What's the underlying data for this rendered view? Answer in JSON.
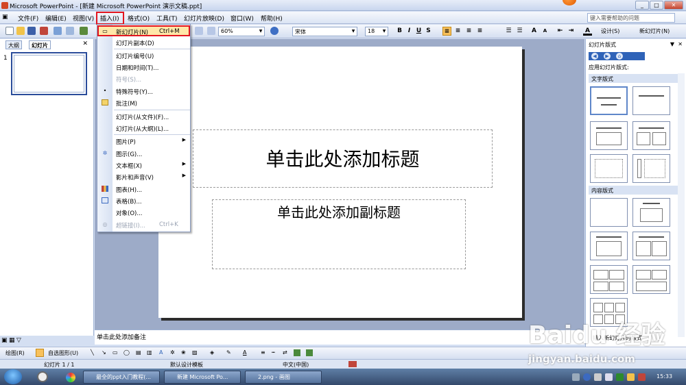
{
  "window": {
    "title": "Microsoft PowerPoint - [新建 Microsoft PowerPoint 演示文稿.ppt]"
  },
  "menubar": {
    "items": [
      "文件(F)",
      "编辑(E)",
      "视图(V)",
      "插入(I)",
      "格式(O)",
      "工具(T)",
      "幻灯片放映(D)",
      "窗口(W)",
      "帮助(H)"
    ],
    "help_placeholder": "键入需要帮助的问题"
  },
  "toolbar": {
    "zoom": "60%",
    "font": "宋体",
    "font_size": "18",
    "bold": "B",
    "italic": "I",
    "underline": "U",
    "shadow": "S",
    "design_label": "设计(S)",
    "new_slide_label": "新幻灯片(N)"
  },
  "insert_menu": {
    "items": [
      {
        "label": "新幻灯片(N)",
        "shortcut": "Ctrl+M",
        "icon": "new-slide-icon"
      },
      {
        "label": "幻灯片副本(D)"
      },
      {
        "label": "幻灯片编号(U)"
      },
      {
        "label": "日期和时间(T)..."
      },
      {
        "label": "符号(S)...",
        "disabled": true
      },
      {
        "label": "特殊符号(Y)...",
        "icon": "bullet-icon"
      },
      {
        "label": "批注(M)",
        "icon": "comment-icon"
      },
      {
        "label": "幻灯片(从文件)(F)..."
      },
      {
        "label": "幻灯片(从大纲)(L)..."
      },
      {
        "label": "图片(P)",
        "submenu": true
      },
      {
        "label": "图示(G)...",
        "icon": "diagram-icon"
      },
      {
        "label": "文本框(X)",
        "submenu": true
      },
      {
        "label": "影片和声音(V)",
        "submenu": true
      },
      {
        "label": "图表(H)...",
        "icon": "chart-icon"
      },
      {
        "label": "表格(B)...",
        "icon": "table-icon"
      },
      {
        "label": "对象(O)..."
      },
      {
        "label": "超链接(I)...",
        "shortcut": "Ctrl+K",
        "disabled": true,
        "icon": "hyperlink-icon"
      }
    ]
  },
  "left_panel": {
    "tabs": [
      "大纲",
      "幻灯片"
    ],
    "slide_number": "1"
  },
  "slide": {
    "title_placeholder": "单击此处添加标题",
    "subtitle_placeholder": "单击此处添加副标题"
  },
  "notes": {
    "placeholder": "单击此处添加备注"
  },
  "task_pane": {
    "title": "幻灯片版式",
    "apply_label": "应用幻灯片版式:",
    "section_text": "文字版式",
    "section_content": "内容版式",
    "insert_option": "插入新幻灯片时版式"
  },
  "draw_toolbar": {
    "draw_label": "绘图(R)",
    "autoshape_label": "自选图形(U)"
  },
  "status": {
    "slide_info": "幻灯片 1 / 1",
    "template": "默认设计模板",
    "language": "中文(中国)"
  },
  "taskbar": {
    "tasks": [
      "最全的ppt入门教程(...",
      "新建 Microsoft Po...",
      "2.png - 画图"
    ],
    "clock": "15:33"
  },
  "watermark": {
    "text": "Baidu 经验",
    "url": "jingyan.baidu.com"
  }
}
